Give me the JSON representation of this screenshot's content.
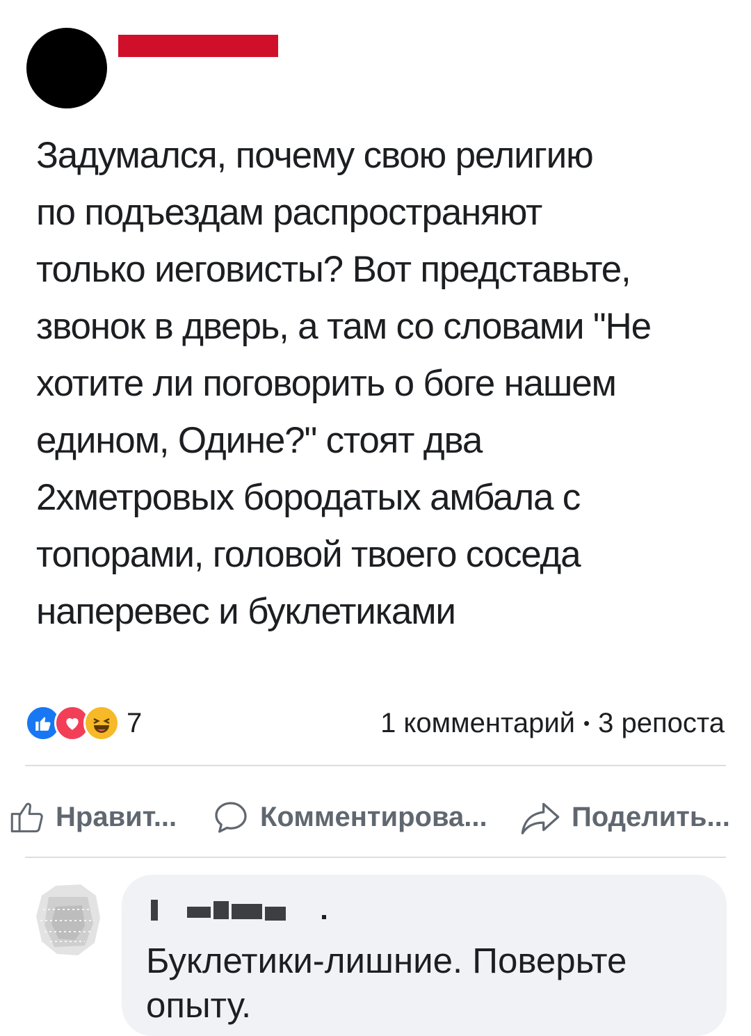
{
  "post": {
    "text_lines": [
      "Задумался, почему свою религию",
      "по подъездам распространяют",
      "только иеговисты? Вот представьте,",
      "звонок в дверь, а там со словами \"Не",
      "хотите ли поговорить о боге нашем",
      "едином, Одине?\" стоят два",
      "2хметровых бородатых амбала с",
      "топорами, головой твоего соседа",
      "наперевес и буклетиками"
    ]
  },
  "reactions": {
    "icons": [
      "like-icon",
      "love-icon",
      "haha-icon"
    ],
    "count": "7"
  },
  "stats": {
    "comments": "1 комментарий",
    "separator": "•",
    "shares": "3 репоста"
  },
  "actions": {
    "like": "Нравит...",
    "comment": "Комментирова...",
    "share": "Поделить..."
  },
  "comment": {
    "text": "Буклетики-лишние. Поверьте опыту."
  },
  "colors": {
    "redaction": "#d0102a",
    "like_blue": "#1877f2",
    "love_red": "#f33e58",
    "haha_yellow": "#f7b928",
    "action_gray": "#606770",
    "bubble_bg": "#f0f2f5"
  }
}
